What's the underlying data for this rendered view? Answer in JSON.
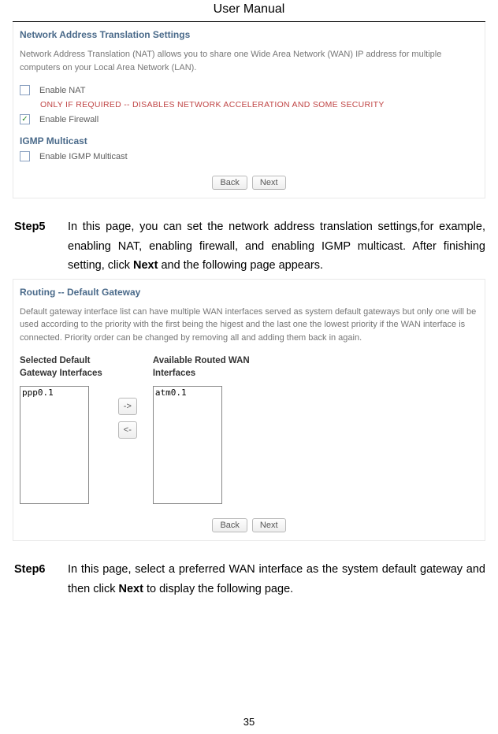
{
  "header": {
    "title": "User Manual"
  },
  "nat_panel": {
    "title": "Network Address Translation Settings",
    "description": "Network Address Translation (NAT) allows you to share one Wide Area Network (WAN) IP address for multiple computers on your Local Area Network (LAN).",
    "enable_nat_label": "Enable NAT",
    "warning": "ONLY IF REQUIRED -- DISABLES NETWORK ACCELERATION AND SOME SECURITY",
    "enable_firewall_label": "Enable Firewall",
    "igmp_heading": "IGMP Multicast",
    "enable_igmp_label": "Enable IGMP Multicast",
    "back_btn": "Back",
    "next_btn": "Next"
  },
  "step5": {
    "label": "Step5",
    "text_pre": "In this page, you can set the network address translation settings,for example, enabling NAT, enabling firewall, and enabling IGMP multicast. After finishing setting, click ",
    "bold": "Next",
    "text_post": " and the following page appears."
  },
  "gw_panel": {
    "title": "Routing -- Default Gateway",
    "description": "Default gateway interface list can have multiple WAN interfaces served as system default gateways but only one will be used according to the priority with the first being the higest and the last one the lowest priority if the WAN interface is connected. Priority order can be changed by removing all and adding them back in again.",
    "left_heading": "Selected Default\nGateway Interfaces",
    "right_heading": "Available Routed WAN\nInterfaces",
    "left_item": "ppp0.1",
    "right_item": "atm0.1",
    "arrow_right": "->",
    "arrow_left": "<-",
    "back_btn": "Back",
    "next_btn": "Next"
  },
  "step6": {
    "label": "Step6",
    "text_pre": "In this page, select a preferred WAN interface as the system default gateway and then click ",
    "bold": "Next",
    "text_post": " to display the following page."
  },
  "page_number": "35"
}
